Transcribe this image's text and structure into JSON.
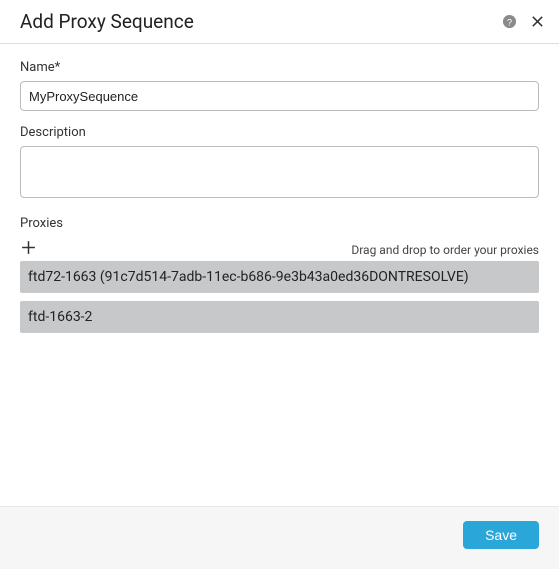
{
  "header": {
    "title": "Add Proxy Sequence"
  },
  "fields": {
    "name": {
      "label": "Name*",
      "value": "MyProxySequence"
    },
    "description": {
      "label": "Description",
      "value": ""
    }
  },
  "proxies": {
    "label": "Proxies",
    "hint": "Drag and drop to order your proxies",
    "items": [
      "ftd72-1663 (91c7d514-7adb-11ec-b686-9e3b43a0ed36DONTRESOLVE)",
      "ftd-1663-2"
    ]
  },
  "footer": {
    "save": "Save"
  }
}
